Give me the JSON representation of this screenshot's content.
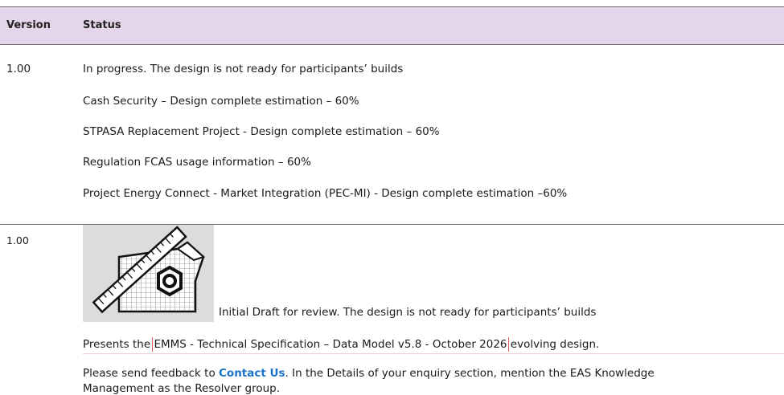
{
  "header": {
    "version": "Version",
    "status": "Status"
  },
  "rows": [
    {
      "version": "1.00",
      "lines": [
        "In progress. The design is not ready for participants’ builds",
        "Cash Security – Design complete estimation – 60%",
        "STPASA Replacement Project - Design complete estimation – 60%",
        "Regulation FCAS usage information – 60%",
        "Project Energy Connect - Market Integration (PEC-MI) - Design complete estimation –60%"
      ]
    },
    {
      "version": "1.00",
      "caption": "Initial Draft for review. The design is not ready for participants’ builds",
      "presents_prefix": "Presents the ",
      "presents_highlight": "EMMS - Technical Specification – Data Model v5.8 - October 2026",
      "presents_suffix": " evolving design.",
      "feedback_prefix": "Please send feedback to ",
      "feedback_link": "Contact Us",
      "feedback_suffix": ". In the Details of your enquiry section, mention the EAS Knowledge",
      "feedback_line2": "Management as the Resolver group."
    }
  ],
  "colors": {
    "header_bg": "#e5d5eb",
    "link": "#1a73c9",
    "rule": "#6b6b6b"
  },
  "icons": {
    "illustration": "design-drawing-icon"
  }
}
